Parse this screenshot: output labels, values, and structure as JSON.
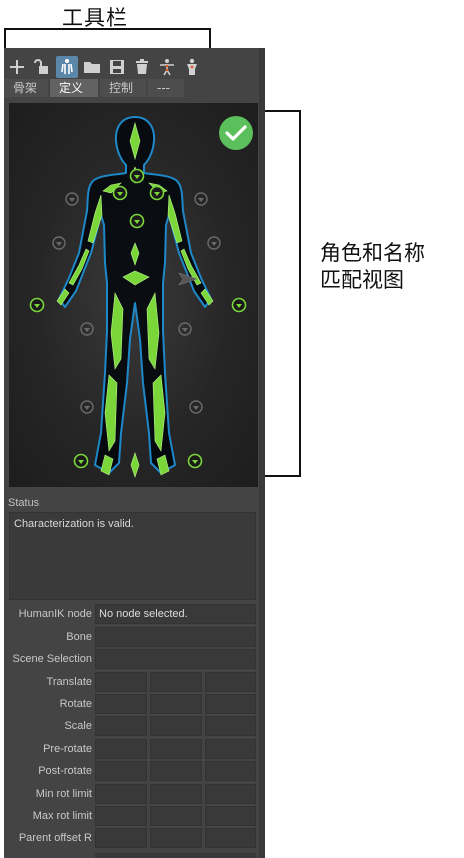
{
  "callouts": {
    "toolbar": "工具栏",
    "view_line1": "角色和名称",
    "view_line2": "匹配视图"
  },
  "toolbar": {
    "buttons": [
      {
        "icon": "plus-icon",
        "active": false
      },
      {
        "icon": "lock-icon",
        "active": false
      },
      {
        "icon": "body-mapping-icon",
        "active": true
      },
      {
        "icon": "folder-icon",
        "active": false
      },
      {
        "icon": "save-icon",
        "active": false
      },
      {
        "icon": "trash-icon",
        "active": false
      },
      {
        "icon": "skeleton-figure-icon",
        "active": false
      },
      {
        "icon": "character-figure-icon",
        "active": false
      }
    ]
  },
  "tabs": [
    "骨架",
    "定义",
    "控制",
    "---"
  ],
  "active_tab": "定义",
  "status": {
    "label": "Status",
    "message": "Characterization is valid."
  },
  "fields": {
    "humanik_node": {
      "label": "HumanIK node",
      "value": "No node selected."
    },
    "bone": {
      "label": "Bone",
      "value": ""
    },
    "scene_selection": {
      "label": "Scene Selection",
      "value": ""
    },
    "translate": {
      "label": "Translate"
    },
    "rotate": {
      "label": "Rotate"
    },
    "scale": {
      "label": "Scale"
    },
    "pre_rotate": {
      "label": "Pre-rotate"
    },
    "post_rotate": {
      "label": "Post-rotate"
    },
    "min_rot_limit": {
      "label": "Min rot limit"
    },
    "max_rot_limit": {
      "label": "Max rot limit"
    },
    "parent_offset": {
      "label": "Parent offset R"
    }
  },
  "colors": {
    "panel": "#444444",
    "bone_green": "#7bd63a",
    "valid_badge": "#5bbf5b",
    "body_outline": "#1e88c8",
    "active_tool": "#5b87a8"
  }
}
